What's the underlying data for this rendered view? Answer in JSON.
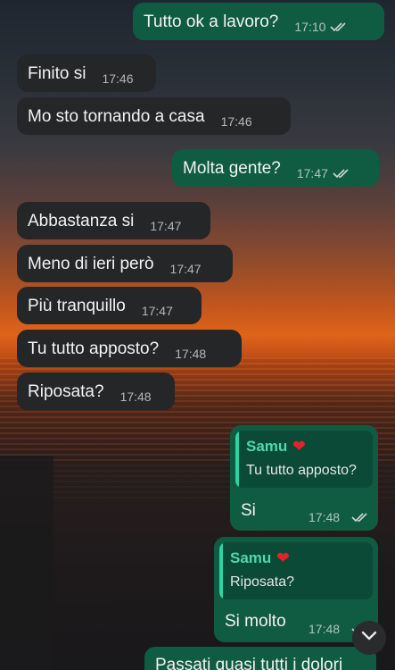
{
  "messages": [
    {
      "id": "m1",
      "dir": "out",
      "text": "Tutto ok a lavoro?",
      "time": "17:10",
      "read": true
    },
    {
      "id": "m2",
      "dir": "in",
      "text": "Finito si",
      "time": "17:46"
    },
    {
      "id": "m3",
      "dir": "in",
      "text": "Mo sto tornando a casa",
      "time": "17:46"
    },
    {
      "id": "m4",
      "dir": "out",
      "text": "Molta gente?",
      "time": "17:47",
      "read": true
    },
    {
      "id": "m5",
      "dir": "in",
      "text": "Abbastanza si",
      "time": "17:47"
    },
    {
      "id": "m6",
      "dir": "in",
      "text": "Meno di ieri però",
      "time": "17:47"
    },
    {
      "id": "m7",
      "dir": "in",
      "text": "Più tranquillo",
      "time": "17:47"
    },
    {
      "id": "m8",
      "dir": "in",
      "text": "Tu tutto apposto?",
      "time": "17:48"
    },
    {
      "id": "m9",
      "dir": "in",
      "text": "Riposata?",
      "time": "17:48"
    }
  ],
  "replies": [
    {
      "id": "r1",
      "author": "Samu",
      "author_emoji": "❤️",
      "quoted": "Tu tutto apposto?",
      "text": "Si",
      "time": "17:48",
      "read": true
    },
    {
      "id": "r2",
      "author": "Samu",
      "author_emoji": "❤️",
      "quoted": "Riposata?",
      "text": "Si molto",
      "time": "17:48",
      "read": true
    }
  ],
  "last_message": {
    "text": "Passati quasi tutti i dolori"
  },
  "colors": {
    "incoming_bubble": "#252628",
    "outgoing_bubble": "#0f5c43",
    "quote_author": "#4fd8a9",
    "quote_bar": "#2fd3a2"
  },
  "icons": {
    "read_receipt": "double-check-icon",
    "scroll_down": "chevron-down-icon"
  }
}
